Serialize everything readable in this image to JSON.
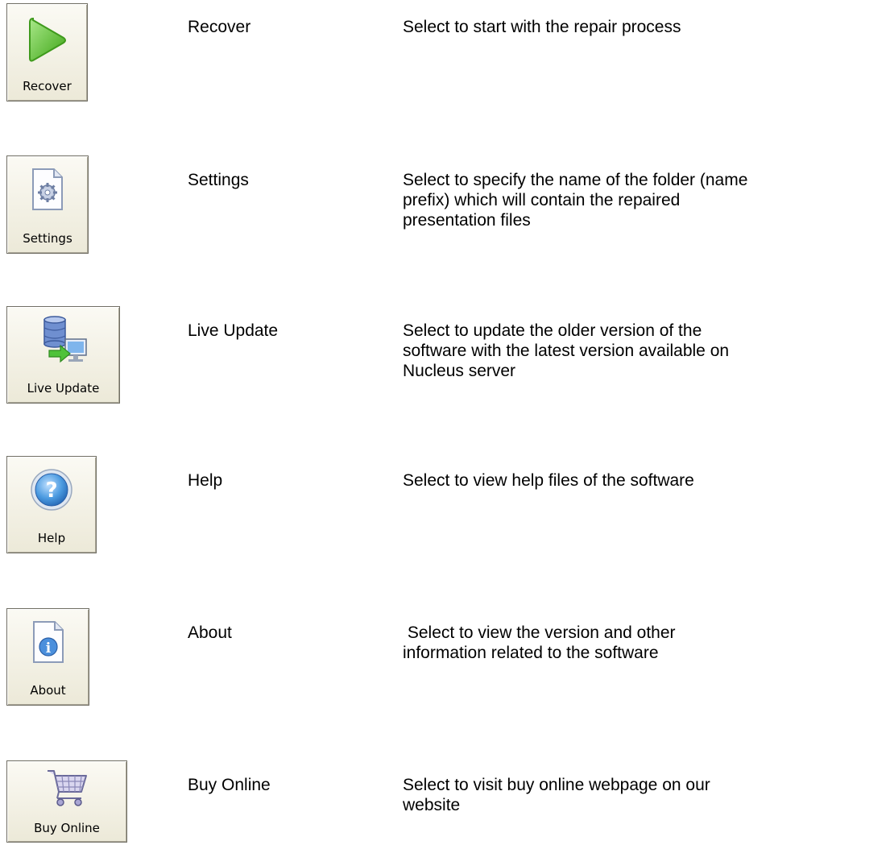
{
  "items": [
    {
      "button_label": "Recover",
      "name": "Recover",
      "description": "Select to start with the repair process",
      "icon": "play-icon"
    },
    {
      "button_label": "Settings",
      "name": "Settings",
      "description": "Select to specify the name of the folder (name\nprefix) which will contain the repaired\npresentation files",
      "icon": "settings-document-icon"
    },
    {
      "button_label": "Live Update",
      "name": "Live Update",
      "description": "Select to update the older version of the\nsoftware with the latest version available on\nNucleus server",
      "icon": "live-update-icon"
    },
    {
      "button_label": "Help",
      "name": "Help",
      "description": "Select to view help files of the software",
      "icon": "help-icon"
    },
    {
      "button_label": "About",
      "name": "About",
      "description": " Select to view the version and other\ninformation related to the software",
      "icon": "info-document-icon"
    },
    {
      "button_label": "Buy Online",
      "name": "Buy Online",
      "description": "Select to visit buy online webpage on our\nwebsite",
      "icon": "shopping-cart-icon"
    }
  ],
  "colors": {
    "button_face": "#ece9d8",
    "button_border": "#716f64",
    "play_green": "#5cc02c",
    "help_blue": "#3b8fd8"
  }
}
